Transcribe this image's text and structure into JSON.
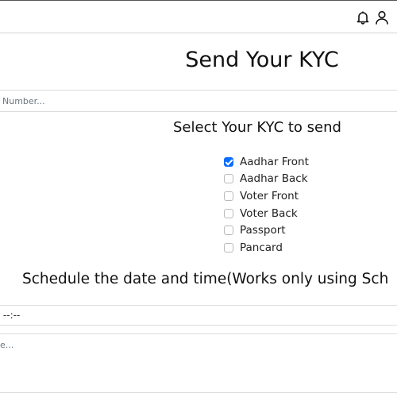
{
  "header": {
    "icons": [
      "bell-icon",
      "user-icon"
    ]
  },
  "page_title": "Send Your KYC",
  "number_input": {
    "placeholder": "Number..."
  },
  "kyc_section": {
    "title": "Select Your KYC to send",
    "options": [
      {
        "label": "Aadhar Front",
        "checked": true
      },
      {
        "label": "Aadhar Back",
        "checked": false
      },
      {
        "label": "Voter Front",
        "checked": false
      },
      {
        "label": "Voter Back",
        "checked": false
      },
      {
        "label": "Passport",
        "checked": false
      },
      {
        "label": "Pancard",
        "checked": false
      }
    ]
  },
  "schedule": {
    "title": "Schedule the date and time(Works only using Sch",
    "datetime_value": "y --:--"
  },
  "message_input": {
    "placeholder": "ge..."
  },
  "colors": {
    "accent": "#0d6efd"
  }
}
